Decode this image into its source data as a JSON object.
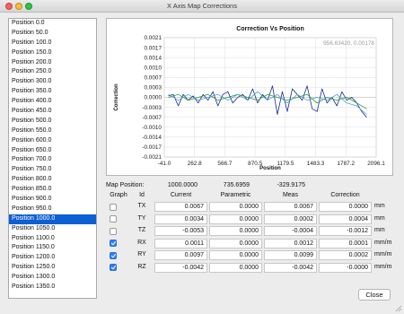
{
  "window": {
    "title": "X Axis Map Corrections"
  },
  "positions": [
    "Position 0.0",
    "Position 50.0",
    "Position 100.0",
    "Position 150.0",
    "Position 200.0",
    "Position 250.0",
    "Position 300.0",
    "Position 350.0",
    "Position 400.0",
    "Position 450.0",
    "Position 500.0",
    "Position 550.0",
    "Position 600.0",
    "Position 650.0",
    "Position 700.0",
    "Position 750.0",
    "Position 800.0",
    "Position 850.0",
    "Position 900.0",
    "Position 950.0",
    "Position 1000.0",
    "Position 1050.0",
    "Position 1100.0",
    "Position 1150.0",
    "Position 1200.0",
    "Position 1250.0",
    "Position 1300.0",
    "Position 1350.0"
  ],
  "selected_position": "Position 1000.0",
  "chart_data": {
    "type": "line",
    "title": "Correction Vs Position",
    "xlabel": "Position",
    "ylabel": "Correction",
    "cursor_readout": "956.63420,    0.00178",
    "x_ticks": [
      "-41.0",
      "262.8",
      "566.7",
      "870.5",
      "1179.5",
      "1483.3",
      "1787.2",
      "2096.1"
    ],
    "y_ticks": [
      "0.0021",
      "0.0017",
      "0.0014",
      "0.0010",
      "0.0007",
      "0.0003",
      "0.0000",
      "-0.0003",
      "-0.0007",
      "-0.0010",
      "-0.0014",
      "-0.0017",
      "-0.0021"
    ],
    "xlim": [
      -41.0,
      2096.1
    ],
    "ylim": [
      -0.0021,
      0.0021
    ],
    "grid": true,
    "series": [
      {
        "color": "#1a2a8c",
        "x": [
          0,
          50,
          100,
          150,
          200,
          250,
          300,
          350,
          400,
          450,
          500,
          550,
          600,
          650,
          700,
          750,
          800,
          850,
          900,
          950,
          1000,
          1050,
          1100,
          1150,
          1200,
          1250,
          1300,
          1350,
          1400,
          1450,
          1500,
          1550,
          1600,
          1650,
          1700,
          1750,
          1800,
          1850,
          1900,
          1950,
          2000
        ],
        "values": [
          5e-05,
          0.0001,
          -0.0003,
          0.0001,
          -0.0001,
          5e-05,
          -0.0002,
          0.0001,
          -0.0001,
          0.0002,
          -0.0003,
          0.0001,
          0.0002,
          -0.0002,
          0.0,
          0.0001,
          -0.0001,
          0.0003,
          -0.0002,
          0.0001,
          -0.0001,
          0.0004,
          -0.0006,
          0.0002,
          -0.0005,
          0.0003,
          0.0001,
          -0.0001,
          0.0004,
          -0.0004,
          -0.0005,
          0.0003,
          -0.0002,
          0.0,
          -0.0003,
          0.0002,
          -0.0001,
          0.0,
          -0.0002,
          -0.0005,
          -0.0007
        ]
      },
      {
        "color": "#2a9a3a",
        "x": [
          0,
          100,
          200,
          300,
          400,
          500,
          600,
          700,
          800,
          900,
          1000,
          1100,
          1200,
          1300,
          1400,
          1500,
          1600,
          1700,
          1800,
          1900,
          2000
        ],
        "values": [
          0.0,
          0.0001,
          -0.0001,
          0.0,
          0.0001,
          -0.0001,
          0.0,
          0.0001,
          0.0,
          -0.0001,
          0.0001,
          0.0,
          -0.0001,
          0.0,
          0.0001,
          -0.0002,
          0.0,
          -0.0001,
          0.0,
          -0.0002,
          -0.0004
        ]
      },
      {
        "color": "#4aa0d0",
        "x": [
          0,
          100,
          200,
          300,
          400,
          500,
          600,
          700,
          800,
          900,
          1000,
          1100,
          1200,
          1300,
          1400,
          1500,
          1600,
          1700,
          1800,
          1900,
          2000
        ],
        "values": [
          0.0001,
          -0.0001,
          0.0001,
          -0.0001,
          0.0,
          0.0001,
          -0.0001,
          0.0001,
          -0.0001,
          0.0002,
          -0.0001,
          0.0001,
          -0.0002,
          0.0001,
          -0.0001,
          0.0,
          -0.0001,
          0.0001,
          -0.0002,
          -0.0003,
          -0.0006
        ]
      }
    ]
  },
  "map_position": {
    "label": "Map Position:",
    "v1": "1000.0000",
    "v2": "735.6959",
    "v3": "-329.9175"
  },
  "table": {
    "headers": {
      "graph": "Graph",
      "id": "Id",
      "current": "Current",
      "parametric": "Parametric",
      "meas": "Meas",
      "correction": "Correction"
    },
    "rows": [
      {
        "id": "TX",
        "checked": false,
        "current": "0.0067",
        "parametric": "0.0000",
        "meas": "0.0067",
        "correction": "0.0000",
        "unit": "mm"
      },
      {
        "id": "TY",
        "checked": false,
        "current": "0.0034",
        "parametric": "0.0000",
        "meas": "0.0002",
        "correction": "0.0004",
        "unit": "mm"
      },
      {
        "id": "TZ",
        "checked": false,
        "current": "-0.0053",
        "parametric": "0.0000",
        "meas": "-0.0004",
        "correction": "-0.0012",
        "unit": "mm"
      },
      {
        "id": "RX",
        "checked": true,
        "current": "0.0011",
        "parametric": "0.0000",
        "meas": "0.0012",
        "correction": "0.0001",
        "unit": "mm/m"
      },
      {
        "id": "RY",
        "checked": true,
        "current": "0.0097",
        "parametric": "0.0000",
        "meas": "0.0099",
        "correction": "0.0002",
        "unit": "mm/m"
      },
      {
        "id": "RZ",
        "checked": true,
        "current": "-0.0042",
        "parametric": "0.0000",
        "meas": "-0.0042",
        "correction": "-0.0000",
        "unit": "mm/m"
      }
    ]
  },
  "buttons": {
    "close": "Close"
  },
  "colors": {
    "selection": "#0c5fd4",
    "checkbox_checked": "#2f7ff5"
  }
}
